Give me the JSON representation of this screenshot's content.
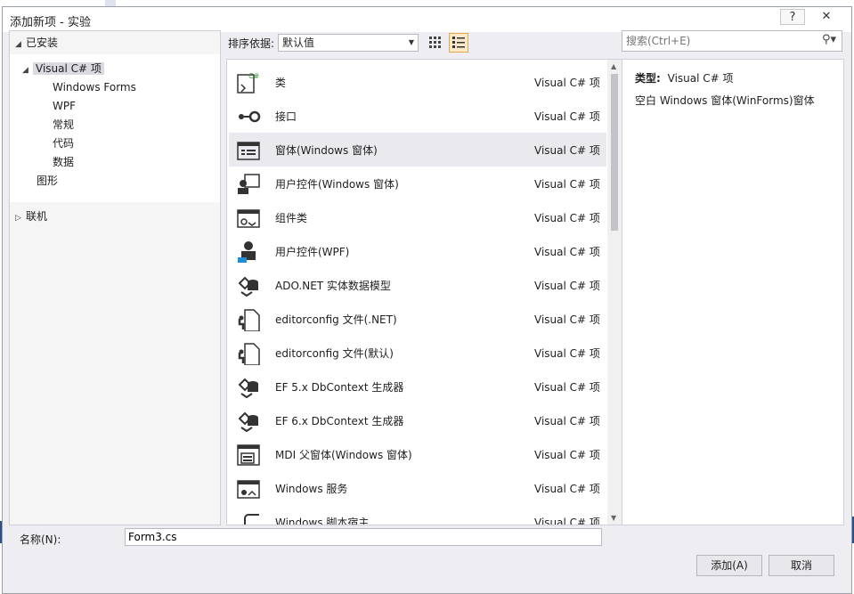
{
  "window": {
    "title": "添加新项 - 实验",
    "help": "?",
    "close": "✕"
  },
  "tree": {
    "installed": "已安装",
    "visual_csharp": "Visual C# 项",
    "children": [
      "Windows Forms",
      "WPF",
      "常规",
      "代码",
      "数据"
    ],
    "graphics": "图形",
    "online": "联机"
  },
  "toolbar": {
    "sort_label": "排序依据:",
    "sort_value": "默认值"
  },
  "search": {
    "placeholder": "搜索(Ctrl+E)"
  },
  "items": [
    {
      "name": "类",
      "type": "Visual C# 项",
      "icon": "class-icon"
    },
    {
      "name": "接口",
      "type": "Visual C# 项",
      "icon": "interface-icon"
    },
    {
      "name": "窗体(Windows 窗体)",
      "type": "Visual C# 项",
      "icon": "form-icon"
    },
    {
      "name": "用户控件(Windows 窗体)",
      "type": "Visual C# 项",
      "icon": "user-control-icon"
    },
    {
      "name": "组件类",
      "type": "Visual C# 项",
      "icon": "component-icon"
    },
    {
      "name": "用户控件(WPF)",
      "type": "Visual C# 项",
      "icon": "wpf-user-control-icon"
    },
    {
      "name": "ADO.NET 实体数据模型",
      "type": "Visual C# 项",
      "icon": "data-model-icon"
    },
    {
      "name": "editorconfig 文件(.NET)",
      "type": "Visual C# 项",
      "icon": "config-file-icon"
    },
    {
      "name": "editorconfig 文件(默认)",
      "type": "Visual C# 项",
      "icon": "config-file-icon"
    },
    {
      "name": "EF 5.x DbContext 生成器",
      "type": "Visual C# 项",
      "icon": "data-model-icon"
    },
    {
      "name": "EF 6.x DbContext 生成器",
      "type": "Visual C# 项",
      "icon": "data-model-icon"
    },
    {
      "name": "MDI 父窗体(Windows 窗体)",
      "type": "Visual C# 项",
      "icon": "mdi-form-icon"
    },
    {
      "name": "Windows 服务",
      "type": "Visual C# 项",
      "icon": "service-icon"
    },
    {
      "name": "Windows 脚本宿主",
      "type": "Visual C# 项",
      "icon": "script-host-icon"
    }
  ],
  "selected_index": 2,
  "details": {
    "type_label": "类型:",
    "type_value": "Visual C# 项",
    "description": "空白 Windows 窗体(WinForms)窗体"
  },
  "name_field": {
    "label": "名称(N):",
    "value": "Form3.cs"
  },
  "buttons": {
    "add": "添加(A)",
    "cancel": "取消"
  }
}
